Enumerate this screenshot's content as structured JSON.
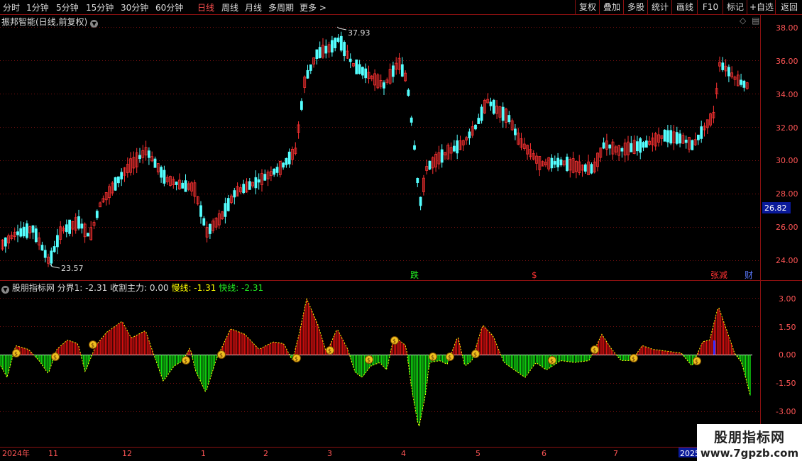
{
  "toolbar": {
    "periods": [
      "分时",
      "1分钟",
      "5分钟",
      "15分钟",
      "30分钟",
      "60分钟",
      "日线",
      "周线",
      "月线",
      "多周期",
      "更多"
    ],
    "active_period": "日线",
    "more_arrow": ">",
    "right_buttons": [
      "复权",
      "叠加",
      "多股",
      "统计",
      "画线",
      "F10",
      "+自选",
      "返回"
    ]
  },
  "main_panel": {
    "title": "振邦智能(日线,前复权)",
    "price_axis": [
      "38.00",
      "36.00",
      "34.00",
      "32.00",
      "30.00",
      "28.00",
      "26.00",
      "24.00"
    ],
    "current_price": "26.82",
    "high_label": "37.93",
    "low_label": "23.57",
    "event_markers": [
      "跌",
      "$",
      "张减",
      "财"
    ]
  },
  "sub_panel": {
    "title": "股朋指标网",
    "fenjie_label": "分界1: -2.31",
    "shouge_label": "收割主力: 0.00",
    "slow_label": "慢线: -1.31",
    "fast_label": "快线: -2.31",
    "axis": [
      "3.00",
      "1.50",
      "0.00",
      "-1.50",
      "-3.00"
    ]
  },
  "date_axis": [
    "2024年",
    "11",
    "12",
    "1",
    "2",
    "3",
    "4",
    "5",
    "6",
    "7",
    "2025"
  ],
  "watermark": {
    "line1": "股朋指标网",
    "line2": "www.7gpzb.com"
  },
  "colors": {
    "up": "#ff3232",
    "down": "#54ffff",
    "grid": "#8a1010",
    "bar_pos": "#e01010",
    "bar_neg": "#10e010",
    "slow_line": "#ffff00"
  }
}
